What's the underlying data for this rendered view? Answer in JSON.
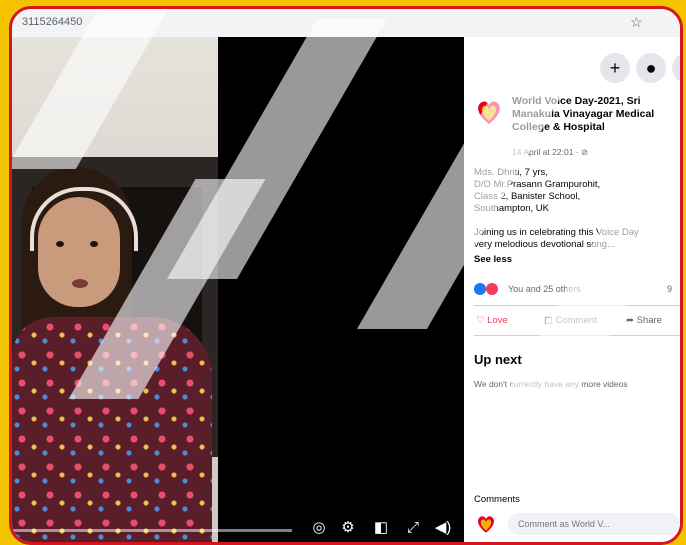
{
  "browser": {
    "url": "3115264450",
    "star_icon": "bookmark-star-icon"
  },
  "video": {
    "progress": 0.0,
    "controls": [
      "captions-icon",
      "settings-gear-icon",
      "miniplayer-icon",
      "fullscreen-icon",
      "volume-icon"
    ]
  },
  "header": {
    "buttons": [
      "plus-icon",
      "messenger-icon",
      "notifications-icon"
    ]
  },
  "post": {
    "title": "World Voice Day-2021, Sri Manakula Vinayagar Medical College & Hospital",
    "meta": "14 April at 22:01 · ⊘",
    "body": [
      "Mds. Dhriti, 7 yrs,",
      "D/O Mr.Prasann Grampurohit,",
      "Class 2, Banister School,",
      "Southampton, UK",
      "",
      "Joining us in celebrating this Voice Day",
      "very melodious devotional song..."
    ],
    "see_less": "See less",
    "reactions_text": "You and 25 others",
    "reactions_count": "9",
    "actions": {
      "love": "Love",
      "comment": "Comment",
      "share": "Share"
    }
  },
  "up_next": {
    "title": "Up next",
    "empty": "We don't currently have any more videos"
  },
  "comments": {
    "label": "Comments",
    "placeholder": "Comment as World V..."
  },
  "colors": {
    "page_background": "#f5c400",
    "frame_border": "#d4161d",
    "love_red": "#f33e58",
    "like_blue": "#1877f2"
  }
}
